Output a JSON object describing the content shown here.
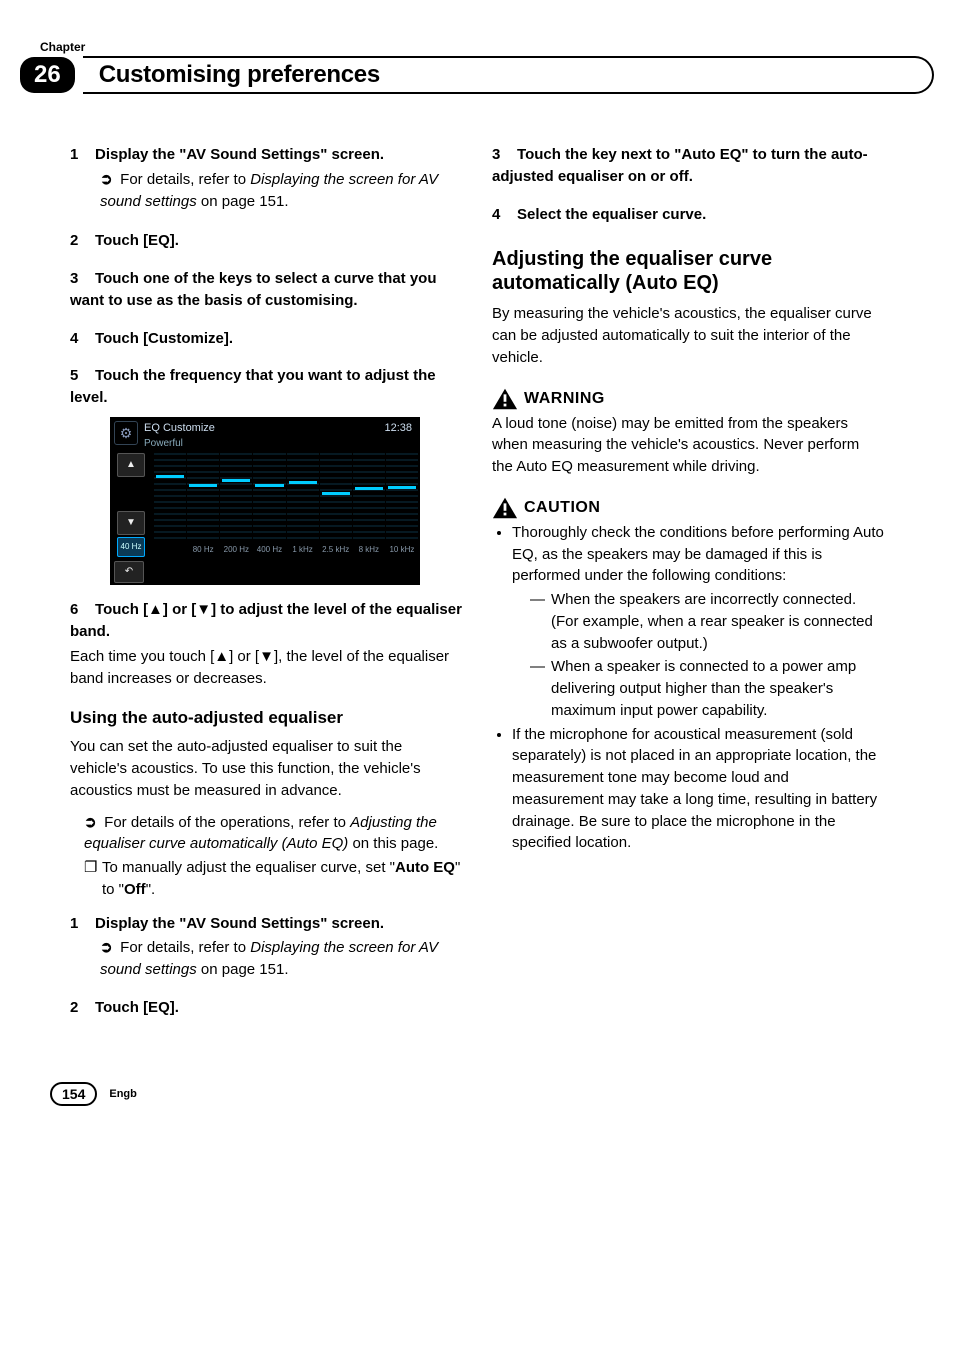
{
  "header": {
    "chapter_label": "Chapter",
    "chapter_number": "26",
    "title": "Customising preferences"
  },
  "left": {
    "step1": {
      "num": "1",
      "head": "Display the \"AV Sound Settings\" screen."
    },
    "ref1_prefix": "For details, refer to ",
    "ref1_italic": "Displaying the screen for AV sound settings",
    "ref1_suffix": " on page 151.",
    "step2": {
      "num": "2",
      "head": "Touch [EQ]."
    },
    "step3": {
      "num": "3",
      "head": "Touch one of the keys to select a curve that you want to use as the basis of customising."
    },
    "step4": {
      "num": "4",
      "head": "Touch [Customize]."
    },
    "step5": {
      "num": "5",
      "head": "Touch the frequency that you want to adjust the level."
    },
    "screenshot": {
      "title": "EQ Customize",
      "subtitle": "Powerful",
      "clock": "12:38",
      "sel": "40 Hz",
      "bands": [
        "80 Hz",
        "200 Hz",
        "400 Hz",
        "1 kHz",
        "2.5 kHz",
        "8 kHz",
        "10 kHz"
      ],
      "levels": [
        72,
        60,
        66,
        60,
        64,
        50,
        56,
        58
      ]
    },
    "step6_a": {
      "num": "6",
      "head": "Touch [▲] or [▼] to adjust the level of the equaliser band."
    },
    "step6_body": "Each time you touch [▲] or [▼], the level of the equaliser band increases or decreases.",
    "h3_auto": "Using the auto-adjusted equaliser",
    "auto_p": "You can set the auto-adjusted equaliser to suit the vehicle's acoustics. To use this function, the vehicle's acoustics must be measured in advance.",
    "auto_ref_prefix": "For details of the operations, refer to ",
    "auto_ref_italic": "Adjusting the equaliser curve automatically (Auto EQ)",
    "auto_ref_suffix": " on this page.",
    "auto_box_a": "To manually adjust the equaliser curve, set \"",
    "auto_box_b": "Auto EQ",
    "auto_box_c": "\" to \"",
    "auto_box_d": "Off",
    "auto_box_e": "\".",
    "step1b": {
      "num": "1",
      "head": "Display the \"AV Sound Settings\" screen."
    },
    "ref1b_prefix": "For details, refer to ",
    "ref1b_italic": "Displaying the screen for AV sound settings",
    "ref1b_suffix": " on page 151.",
    "step2b": {
      "num": "2",
      "head": "Touch [EQ]."
    }
  },
  "right": {
    "step3": {
      "num": "3",
      "head": "Touch the key next to \"Auto EQ\" to turn the auto-adjusted equaliser on or off."
    },
    "step4": {
      "num": "4",
      "head": "Select the equaliser curve."
    },
    "h2": "Adjusting the equaliser curve automatically (Auto EQ)",
    "p_auto": "By measuring the vehicle's acoustics, the equaliser curve can be adjusted automatically to suit the interior of the vehicle.",
    "warn_label": "WARNING",
    "warn_text": "A loud tone (noise) may be emitted from the speakers when measuring the vehicle's acoustics. Never perform the Auto EQ measurement while driving.",
    "caution_label": "CAUTION",
    "caution_b1": "Thoroughly check the conditions before performing Auto EQ, as the speakers may be damaged if this is performed under the following conditions:",
    "caution_b1_d1": "When the speakers are incorrectly connected. (For example, when a rear speaker is connected as a subwoofer output.)",
    "caution_b1_d2": "When a speaker is connected to a power amp delivering output higher than the speaker's maximum input power capability.",
    "caution_b2": "If the microphone for acoustical measurement (sold separately) is not placed in an appropriate location, the measurement tone may become loud and measurement may take a long time, resulting in battery drainage. Be sure to place the microphone in the specified location."
  },
  "footer": {
    "page": "154",
    "lang": "Engb"
  },
  "icons": {
    "ref": "➲",
    "box": "❐",
    "dash": "—",
    "up": "▲",
    "down": "▼",
    "back": "↶",
    "gear": "⚙"
  }
}
